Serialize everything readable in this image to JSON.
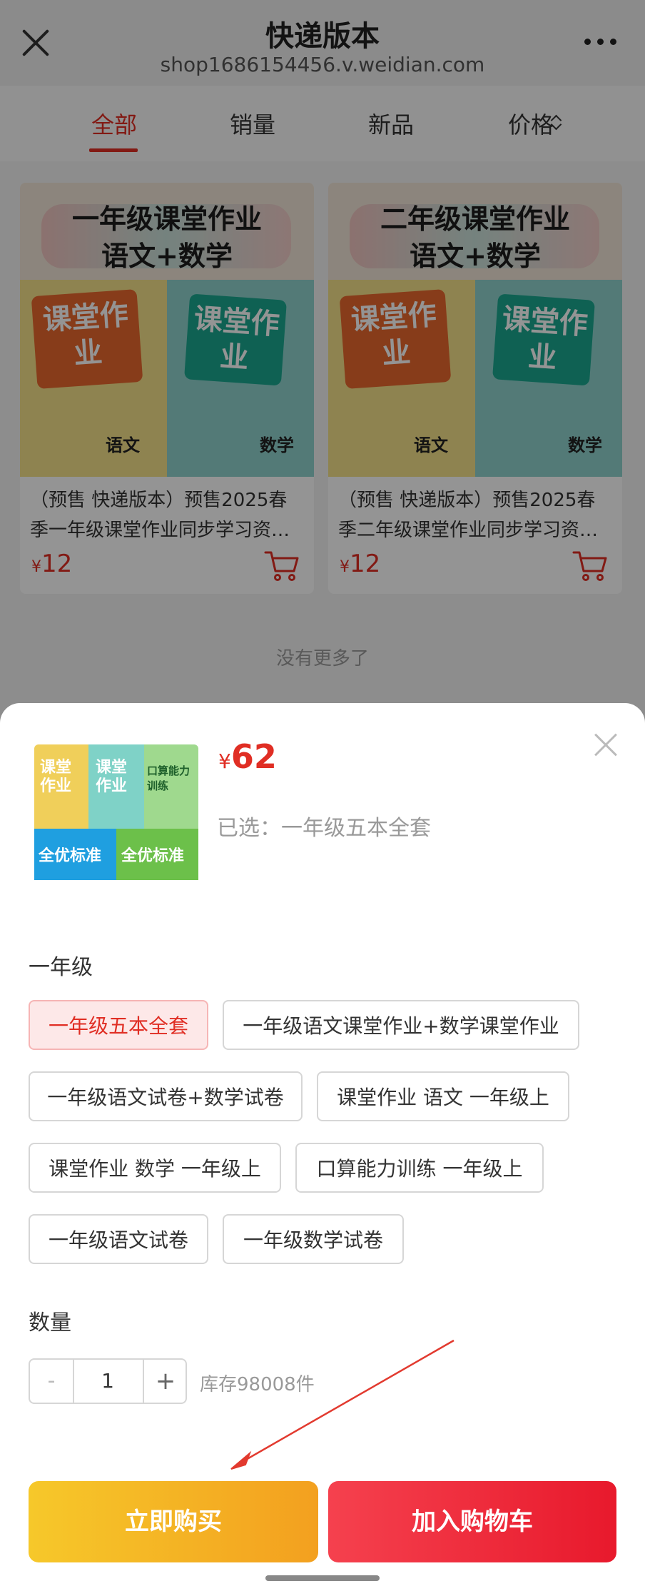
{
  "header": {
    "title": "快递版本",
    "url": "shop1686154456.v.weidian.com"
  },
  "tabs": [
    {
      "label": "全部",
      "active": true
    },
    {
      "label": "销量"
    },
    {
      "label": "新品"
    },
    {
      "label": "价格"
    }
  ],
  "products": [
    {
      "image_title_1": "一年级课堂作业",
      "image_title_2": "语文+数学",
      "badge": "课堂作业",
      "subject_l": "语文",
      "subject_r": "数学",
      "name_line1": "（预售 快递版本）预售2025春",
      "name_line2": "季一年级课堂作业同步学习资…",
      "currency": "¥",
      "price": "12"
    },
    {
      "image_title_1": "二年级课堂作业",
      "image_title_2": "语文+数学",
      "badge": "课堂作业",
      "subject_l": "语文",
      "subject_r": "数学",
      "name_line1": "（预售 快递版本）预售2025春",
      "name_line2": "季二年级课堂作业同步学习资…",
      "currency": "¥",
      "price": "12"
    }
  ],
  "list_end_text": "没有更多了",
  "sheet": {
    "currency": "¥",
    "price": "62",
    "selected_prefix": "已选：",
    "selected_value": "一年级五本全套",
    "thumb_text": {
      "badge_1": "课堂作业",
      "badge_2": "课堂作业",
      "book_3": "口算能力训练",
      "book_4": "全优标准",
      "book_5": "全优标准"
    },
    "group_title": "一年级",
    "options": [
      {
        "label": "一年级五本全套",
        "selected": true
      },
      {
        "label": "一年级语文课堂作业+数学课堂作业"
      },
      {
        "label": "一年级语文试卷+数学试卷"
      },
      {
        "label": "课堂作业 语文 一年级上"
      },
      {
        "label": "课堂作业 数学 一年级上"
      },
      {
        "label": "口算能力训练 一年级上"
      },
      {
        "label": "一年级语文试卷"
      },
      {
        "label": "一年级数学试卷"
      }
    ],
    "quantity_label": "数量",
    "minus": "-",
    "quantity": "1",
    "plus": "+",
    "stock": "库存98008件",
    "buy_now": "立即购买",
    "add_to_cart": "加入购物车"
  },
  "colors": {
    "accent": "#e02e24",
    "buy_button": "#f3a01f",
    "cart_button": "#e8192c"
  }
}
